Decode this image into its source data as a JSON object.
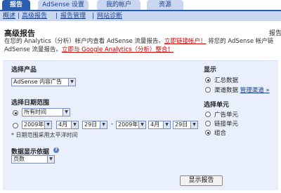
{
  "tabs": [
    {
      "label": "报告"
    },
    {
      "label": "AdSense 设置"
    },
    {
      "label": "我的帐户"
    },
    {
      "label": "资源"
    }
  ],
  "subnav": {
    "items": [
      "概述",
      "高级报告",
      "报告管理",
      "网站诊断"
    ],
    "separator": "|"
  },
  "page": {
    "title": "高级报告",
    "title_right": "报告"
  },
  "intro": {
    "line1_prefix": "在您的 Analytics（分析）帐户内查看 AdSense 流量报告。",
    "line1_link": "立即链接帐户！",
    "line1_suffix": " 将您的 AdSense 帐户链",
    "line2_prefix": "AdSense 流量报告。",
    "line2_link": "立即与 Google Analytics（分析）整合！"
  },
  "product": {
    "label": "选择产品",
    "value": "AdSense 内容广告"
  },
  "date_range": {
    "label": "选择日期范围",
    "preset": "所有时间",
    "from": {
      "year": "2009年",
      "month": "4月",
      "day": "29日"
    },
    "dash": "-",
    "to": {
      "year": "2009年",
      "month": "4月",
      "day": "29日"
    },
    "note": "* 日期范围采用太平洋时间"
  },
  "display": {
    "label": "显示",
    "options": [
      "汇总数据",
      "渠道数据"
    ],
    "selected": 0,
    "manage_link": "管理渠道 »"
  },
  "unit": {
    "label": "选择单元",
    "options": [
      "广告单元",
      "链接单元",
      "组合"
    ],
    "selected": 2
  },
  "show_by": {
    "label": "数据显示依据",
    "help": "?",
    "value": "页数"
  },
  "submit_label": "显示报告",
  "colors": {
    "tab_active": "#2a5db0",
    "tab_inactive": "#c9d7f1",
    "panel": "#eaf0fb",
    "link_red": "#cc0000",
    "link_blue": "#1a3f8f"
  }
}
